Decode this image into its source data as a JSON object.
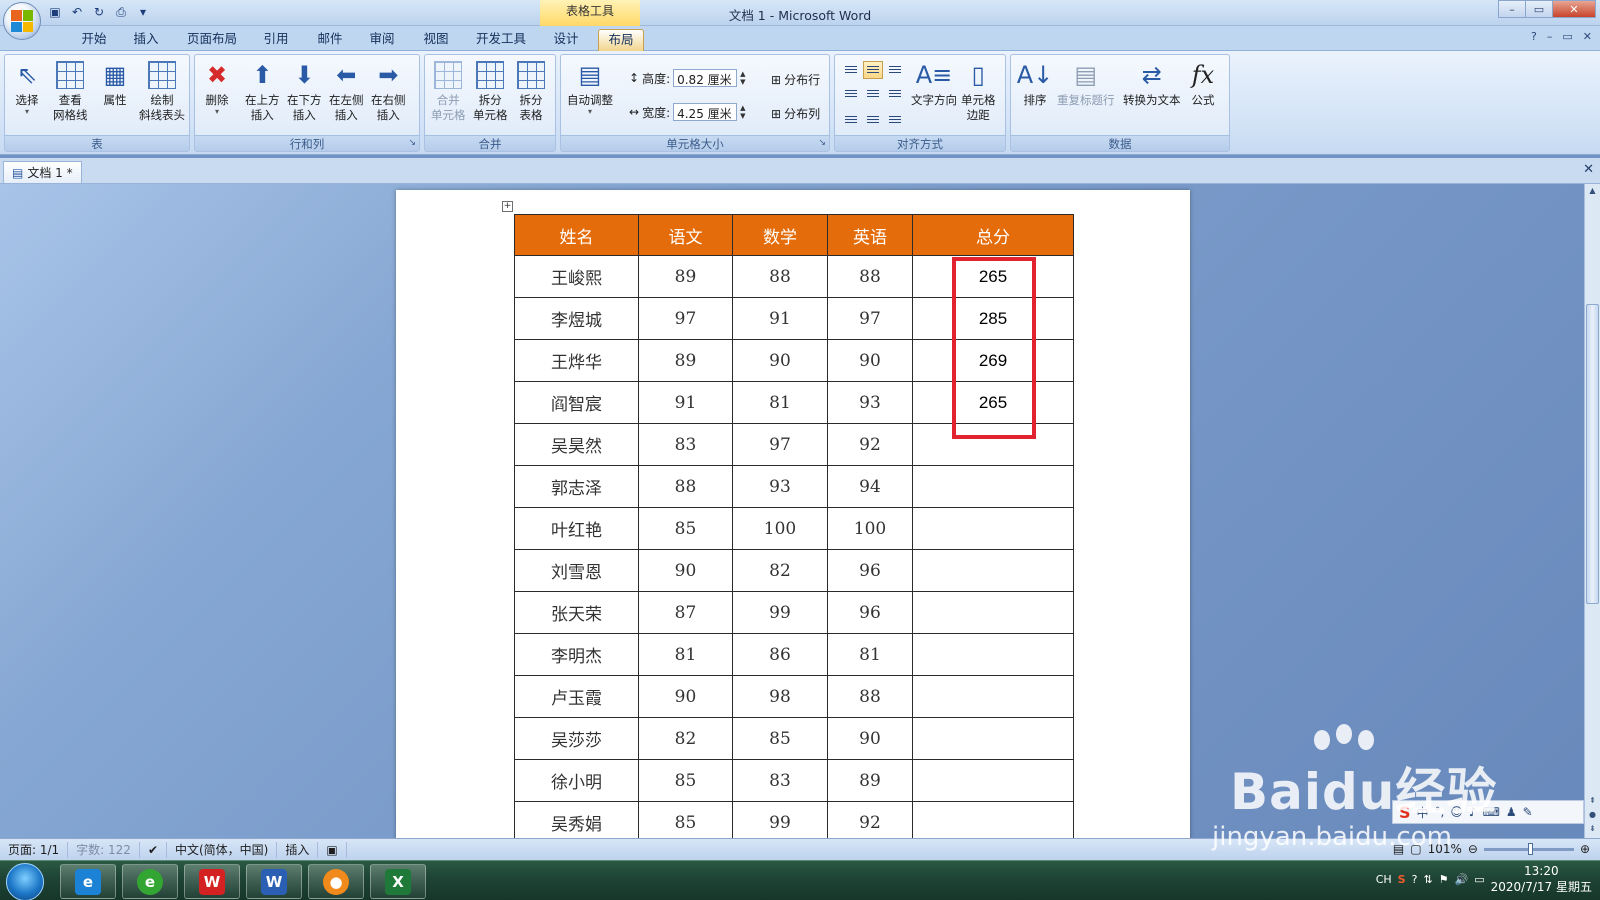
{
  "window": {
    "title": "文档 1 - Microsoft Word",
    "context_tab": "表格工具",
    "controls": {
      "minimize": "–",
      "maximize": "▭",
      "close": "✕"
    }
  },
  "quick_access": [
    "save-icon",
    "undo-icon",
    "redo-icon",
    "print-preview-icon",
    "customize-icon"
  ],
  "tabs": [
    {
      "label": "开始"
    },
    {
      "label": "插入"
    },
    {
      "label": "页面布局"
    },
    {
      "label": "引用"
    },
    {
      "label": "邮件"
    },
    {
      "label": "审阅"
    },
    {
      "label": "视图"
    },
    {
      "label": "开发工具"
    },
    {
      "label": "设计"
    },
    {
      "label": "布局",
      "active": true
    }
  ],
  "ribbon": {
    "groups": {
      "table": {
        "name": "表",
        "select": "选择",
        "gridlines": "查看\n网格线",
        "properties": "属性",
        "diagonal": "绘制\n斜线表头"
      },
      "rows_cols": {
        "name": "行和列",
        "delete": "删除",
        "insert_above": "在上方\n插入",
        "insert_below": "在下方\n插入",
        "insert_left": "在左侧\n插入",
        "insert_right": "在右侧\n插入"
      },
      "merge": {
        "name": "合并",
        "merge_cells": "合并\n单元格",
        "split_cells": "拆分\n单元格",
        "split_table": "拆分\n表格"
      },
      "cell_size": {
        "name": "单元格大小",
        "autofit": "自动调整",
        "height_label": "高度:",
        "height_value": "0.82 厘米",
        "width_label": "宽度:",
        "width_value": "4.25 厘米",
        "distribute_rows": "分布行",
        "distribute_cols": "分布列"
      },
      "alignment": {
        "name": "对齐方式",
        "text_direction": "文字方向",
        "cell_margins": "单元格\n边距"
      },
      "data": {
        "name": "数据",
        "sort": "排序",
        "repeat_header": "重复标题行",
        "to_text": "转换为文本",
        "formula": "公式"
      }
    }
  },
  "document_tab": {
    "label": "文档 1 *"
  },
  "table": {
    "headers": [
      "姓名",
      "语文",
      "数学",
      "英语",
      "总分"
    ],
    "rows": [
      [
        "王峻熙",
        "89",
        "88",
        "88",
        "265"
      ],
      [
        "李煜城",
        "97",
        "91",
        "97",
        "285"
      ],
      [
        "王烨华",
        "89",
        "90",
        "90",
        "269"
      ],
      [
        "阎智宸",
        "91",
        "81",
        "93",
        "265"
      ],
      [
        "吴昊然",
        "83",
        "97",
        "92",
        ""
      ],
      [
        "郭志泽",
        "88",
        "93",
        "94",
        ""
      ],
      [
        "叶红艳",
        "85",
        "100",
        "100",
        ""
      ],
      [
        "刘雪恩",
        "90",
        "82",
        "96",
        ""
      ],
      [
        "张天荣",
        "87",
        "99",
        "96",
        ""
      ],
      [
        "李明杰",
        "81",
        "86",
        "81",
        ""
      ],
      [
        "卢玉霞",
        "90",
        "98",
        "88",
        ""
      ],
      [
        "吴莎莎",
        "82",
        "85",
        "90",
        ""
      ],
      [
        "徐小明",
        "85",
        "83",
        "89",
        ""
      ],
      [
        "吴秀娟",
        "85",
        "99",
        "92",
        ""
      ]
    ],
    "header_color": "#e46c0a",
    "highlight_color": "#e0232e"
  },
  "statusbar": {
    "page": "页面: 1/1",
    "words": "字数: 122",
    "language": "中文(简体，中国)",
    "mode": "插入",
    "zoom": "101%"
  },
  "watermark": {
    "main": "Baidu经验",
    "sub": "jingyan.baidu.com"
  },
  "taskbar": {
    "apps": [
      "ie-icon",
      "browser-icon",
      "wps-icon",
      "word-icon",
      "media-icon",
      "excel-icon"
    ],
    "tray_lang": "CH",
    "time": "13:20",
    "date": "2020/7/17 星期五"
  }
}
